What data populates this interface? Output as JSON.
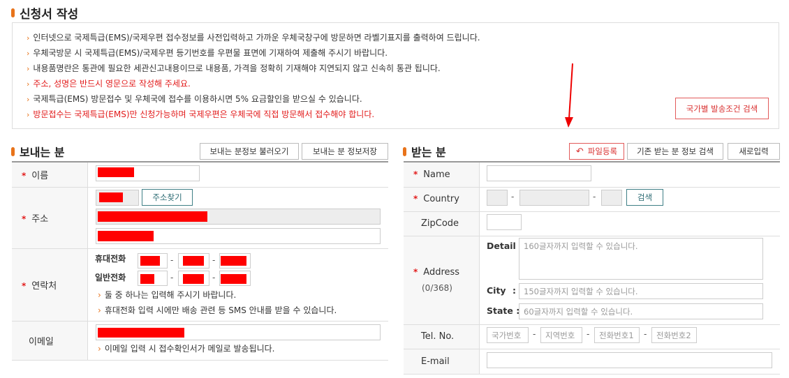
{
  "page_title": "신청서 작성",
  "notices": [
    {
      "text": "인터넷으로 국제특급(EMS)/국제우편 접수정보를 사전입력하고 가까운 우체국창구에 방문하면 라벨기표지를 출력하여 드립니다.",
      "red": false
    },
    {
      "text": "우체국방문 시 국제특급(EMS)/국제우편 등기번호를 우편물 표면에 기재하여 제출해 주시기 바랍니다.",
      "red": false
    },
    {
      "text": "내용품명란은 통관에 필요한 세관신고내용이므로 내용품, 가격을 정확히 기재해야 지연되지 않고 신속히 통관 됩니다.",
      "red": false
    },
    {
      "text": "주소, 성명은 반드시 영문으로 작성해 주세요.",
      "red": true
    },
    {
      "text": "국제특급(EMS) 방문접수 및 우체국에 접수를 이용하시면 5% 요금할인을 받으실 수 있습니다.",
      "red": false
    },
    {
      "text": "방문접수는 국제특급(EMS)만 신청가능하며 국제우편은 우체국에 직접 방문해서 접수해야 합니다.",
      "red": true
    }
  ],
  "country_conditions_button": "국가별 발송조건 검색",
  "sender": {
    "title": "보내는 분",
    "load_button": "보내는 분정보 불러오기",
    "save_button": "보내는 분 정보저장",
    "name_label": "이름",
    "address_label": "주소",
    "address_search_button": "주소찾기",
    "contact_label": "연락처",
    "mobile_label": "휴대전화",
    "phone_label": "일반전화",
    "contact_note1": "둘 중 하나는 입력해 주시기 바랍니다.",
    "contact_note2": "휴대전화 입력 시에만 배송 관련 등 SMS 안내를 받을 수 있습니다.",
    "email_label": "이메일",
    "email_note": "이메일 입력 시 접수확인서가 메일로 발송됩니다."
  },
  "receiver": {
    "title": "받는 분",
    "file_button": "파일등록",
    "existing_button": "기존 받는 분 정보 검색",
    "new_button": "새로입력",
    "name_label": "Name",
    "country_label": "Country",
    "country_search_button": "검색",
    "zipcode_label": "ZipCode",
    "address_label": "Address",
    "address_count": "(0/368)",
    "detail_label": "Detail :",
    "detail_placeholder": "160글자까지 입력할 수 있습니다.",
    "city_label": "City",
    "city_placeholder": "150글자까지 입력할 수 있습니다.",
    "state_label": "State :",
    "state_placeholder": "60글자까지 입력할 수 있습니다.",
    "tel_label": "Tel. No.",
    "tel_country_placeholder": "국가번호",
    "tel_area_placeholder": "지역번호",
    "tel_num1_placeholder": "전화번호1",
    "tel_num2_placeholder": "전화번호2",
    "email_label": "E-mail"
  },
  "colors": {
    "accent": "#e8731a",
    "required": "#e21b1b",
    "redaction": "#ff0000"
  }
}
